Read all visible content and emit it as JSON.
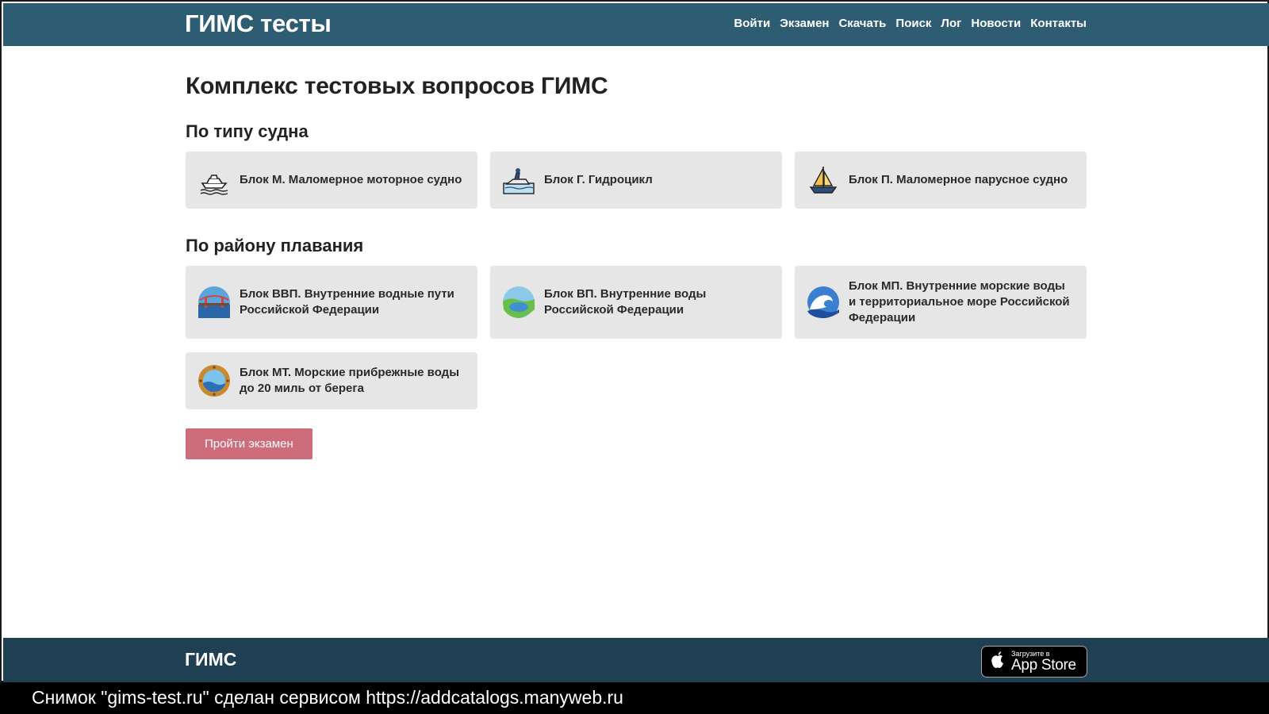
{
  "header": {
    "brand": "ГИМС тесты",
    "nav": [
      "Войти",
      "Экзамен",
      "Скачать",
      "Поиск",
      "Лог",
      "Новости",
      "Контакты"
    ]
  },
  "main": {
    "title": "Комплекс тестовых вопросов ГИМС",
    "section_vessel": {
      "title": "По типу судна",
      "cards": [
        {
          "label": "Блок М. Маломерное моторное судно",
          "icon": "motor-boat-icon"
        },
        {
          "label": "Блок Г. Гидроцикл",
          "icon": "jet-ski-icon"
        },
        {
          "label": "Блок П. Маломерное парусное судно",
          "icon": "sailboat-icon"
        }
      ]
    },
    "section_area": {
      "title": "По району плавания",
      "cards": [
        {
          "label": "Блок ВВП. Внутренние водные пути Российской Федерации",
          "icon": "bridge-icon"
        },
        {
          "label": "Блок ВП. Внутренние воды Российской Федерации",
          "icon": "lake-icon"
        },
        {
          "label": "Блок МП. Внутренние морские воды и территориальное море Российской Федерации",
          "icon": "wave-icon"
        },
        {
          "label": "Блок МТ. Морские прибрежные воды до 20 миль от берега",
          "icon": "porthole-icon"
        }
      ]
    },
    "exam_button": "Пройти экзамен"
  },
  "footer": {
    "brand": "ГИМС",
    "appstore_small": "Загрузите в",
    "appstore_big": "App Store"
  },
  "caption": "Снимок \"gims-test.ru\" сделан сервисом https://addcatalogs.manyweb.ru",
  "colors": {
    "header_bg": "#2e5c72",
    "footer_bg": "#1f3f52",
    "card_bg": "#e6e6e6",
    "button_bg": "#cf6c7b"
  }
}
